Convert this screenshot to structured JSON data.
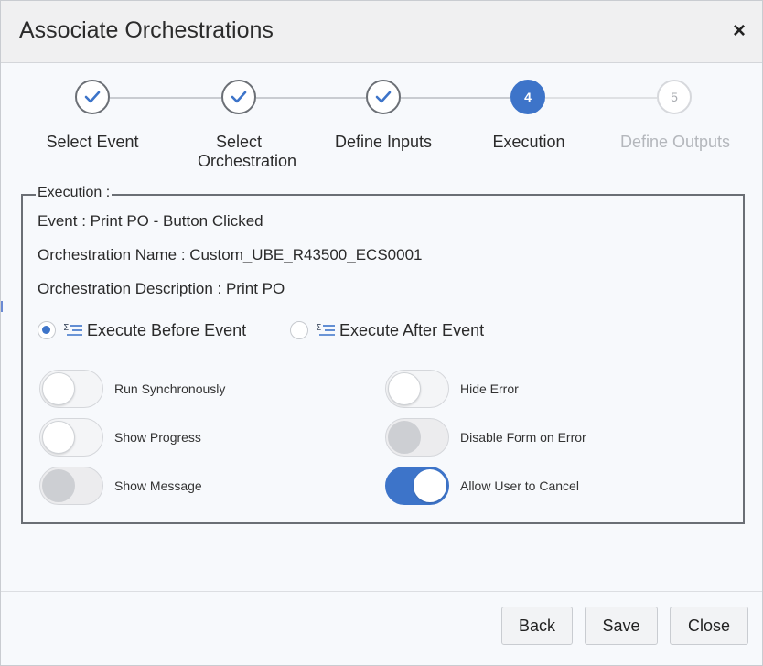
{
  "dialog": {
    "title": "Associate Orchestrations",
    "close_symbol": "×"
  },
  "stepper": {
    "steps": [
      {
        "label": "Select Event",
        "state": "done",
        "icon": "check-icon"
      },
      {
        "label": "Select Orchestration",
        "state": "done",
        "icon": "check-icon"
      },
      {
        "label": "Define Inputs",
        "state": "done",
        "icon": "check-icon"
      },
      {
        "label": "Execution",
        "state": "active",
        "number": "4"
      },
      {
        "label": "Define Outputs",
        "state": "future",
        "number": "5"
      }
    ]
  },
  "execution": {
    "legend": "Execution :",
    "event_line": "Event : Print PO - Button Clicked",
    "orchestration_name_line": "Orchestration Name : Custom_UBE_R43500_ECS0001",
    "orchestration_description_line": "Orchestration Description : Print PO",
    "radio_before_label": "Execute Before Event",
    "radio_before_checked": true,
    "radio_after_label": "Execute After Event",
    "radio_after_checked": false,
    "toggles": {
      "run_synchronously": {
        "label": "Run Synchronously",
        "state": "off"
      },
      "show_progress": {
        "label": "Show Progress",
        "state": "off"
      },
      "show_message": {
        "label": "Show Message",
        "state": "disabled"
      },
      "hide_error": {
        "label": "Hide Error",
        "state": "off"
      },
      "disable_form_on_error": {
        "label": "Disable Form on Error",
        "state": "disabled"
      },
      "allow_user_to_cancel": {
        "label": "Allow User to Cancel",
        "state": "on"
      }
    }
  },
  "footer": {
    "back_label": "Back",
    "save_label": "Save",
    "close_label": "Close"
  },
  "colors": {
    "accent": "#3d74c9",
    "check": "#3d74c9",
    "border": "#6b6f75"
  }
}
